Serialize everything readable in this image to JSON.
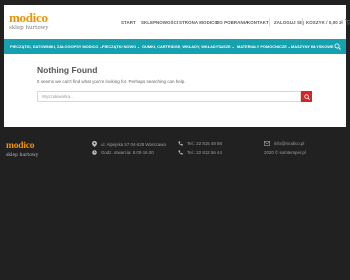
{
  "logo": {
    "brand": "modico",
    "tagline": "sklep hurtowy"
  },
  "topnav": {
    "items": [
      "START",
      "SKLEP",
      "NOWOŚCI",
      "STRONA MODICO",
      "DO POBRANIA",
      "KONTAKT"
    ],
    "login": "ZALOGUJ SIĘ",
    "cart": "KOSZYK / 0,00 zł"
  },
  "categories": [
    "PIECZĄTKI, DATOWNIKI, ZAŁOGOPSY MODICO",
    "PIECZĄTKI NOWO",
    "GUMKI, CARTRIDGE, WKŁADY, WKŁADY",
    "TUSZE",
    "MATERIAŁY POMOCNICZE",
    "MASZYNY BŁYSKOWE"
  ],
  "main": {
    "title": "Nothing Found",
    "message": "It seems we can't find what you're looking for. Perhaps searching can help.",
    "search_placeholder": "Wyszukiwarka..."
  },
  "footer": {
    "logo": {
      "brand": "modico",
      "tagline": "sklep hurtowy"
    },
    "address": "ul. Alpejska 57 04-628 Warszawa",
    "hours": "Godz. otwarcia: 8.00-16.00",
    "phone1": "Tel.: 22 815 48 88",
    "phone2": "Tel.: 22 812 56 44",
    "email": "info@modico.pl",
    "copyright": "2020 © somtemper.pl"
  },
  "colors": {
    "accent": "#f39200",
    "teal": "#15a1ad",
    "search_red": "#d12727"
  }
}
